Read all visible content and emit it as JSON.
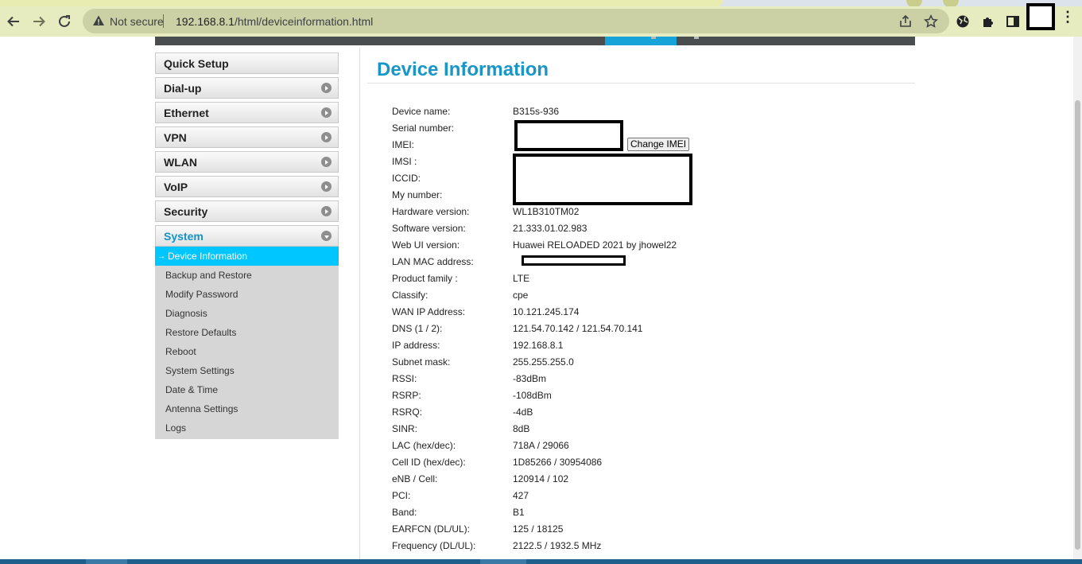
{
  "browser": {
    "not_secure_label": "Not secure",
    "url_host": "192.168.8.1",
    "url_path": "/html/deviceinformation.html"
  },
  "sidebar": {
    "items": [
      {
        "label": "Quick Setup"
      },
      {
        "label": "Dial-up"
      },
      {
        "label": "Ethernet"
      },
      {
        "label": "VPN"
      },
      {
        "label": "WLAN"
      },
      {
        "label": "VoIP"
      },
      {
        "label": "Security"
      },
      {
        "label": "System"
      }
    ],
    "system_subitems": [
      {
        "label": "Device Information"
      },
      {
        "label": "Backup and Restore"
      },
      {
        "label": "Modify Password"
      },
      {
        "label": "Diagnosis"
      },
      {
        "label": "Restore Defaults"
      },
      {
        "label": "Reboot"
      },
      {
        "label": "System Settings"
      },
      {
        "label": "Date & Time"
      },
      {
        "label": "Antenna Settings"
      },
      {
        "label": "Logs"
      }
    ]
  },
  "content": {
    "title": "Device Information",
    "change_imei_label": "Change IMEI",
    "rows": [
      {
        "label": "Device name:",
        "value": "B315s-936"
      },
      {
        "label": "Serial number:",
        "value": ""
      },
      {
        "label": "IMEI:",
        "value": ""
      },
      {
        "label": "IMSI :",
        "value": ""
      },
      {
        "label": "ICCID:",
        "value": ""
      },
      {
        "label": "My number:",
        "value": ""
      },
      {
        "label": "Hardware version:",
        "value": "WL1B310TM02"
      },
      {
        "label": "Software version:",
        "value": "21.333.01.02.983"
      },
      {
        "label": "Web UI version:",
        "value": "Huawei RELOADED 2021 by jhowel22"
      },
      {
        "label": "LAN MAC address:",
        "value": ""
      },
      {
        "label": "Product family :",
        "value": "LTE"
      },
      {
        "label": "Classify:",
        "value": "cpe"
      },
      {
        "label": "WAN IP Address:",
        "value": "10.121.245.174"
      },
      {
        "label": "DNS (1 / 2):",
        "value": "121.54.70.142 / 121.54.70.141"
      },
      {
        "label": "IP address:",
        "value": "192.168.8.1"
      },
      {
        "label": "Subnet mask:",
        "value": "255.255.255.0"
      },
      {
        "label": "RSSI:",
        "value": "-83dBm"
      },
      {
        "label": "RSRP:",
        "value": "-108dBm"
      },
      {
        "label": "RSRQ:",
        "value": "-4dB"
      },
      {
        "label": "SINR:",
        "value": "8dB"
      },
      {
        "label": "LAC (hex/dec):",
        "value": "718A / 29066"
      },
      {
        "label": "Cell ID (hex/dec):",
        "value": "1D85266 / 30954086"
      },
      {
        "label": "eNB / Cell:",
        "value": "120914 / 102"
      },
      {
        "label": "PCI:",
        "value": "427"
      },
      {
        "label": "Band:",
        "value": "B1"
      },
      {
        "label": "EARFCN (DL/UL):",
        "value": "125 / 18125"
      },
      {
        "label": "Frequency (DL/UL):",
        "value": "2122.5 / 1932.5 MHz"
      }
    ]
  }
}
